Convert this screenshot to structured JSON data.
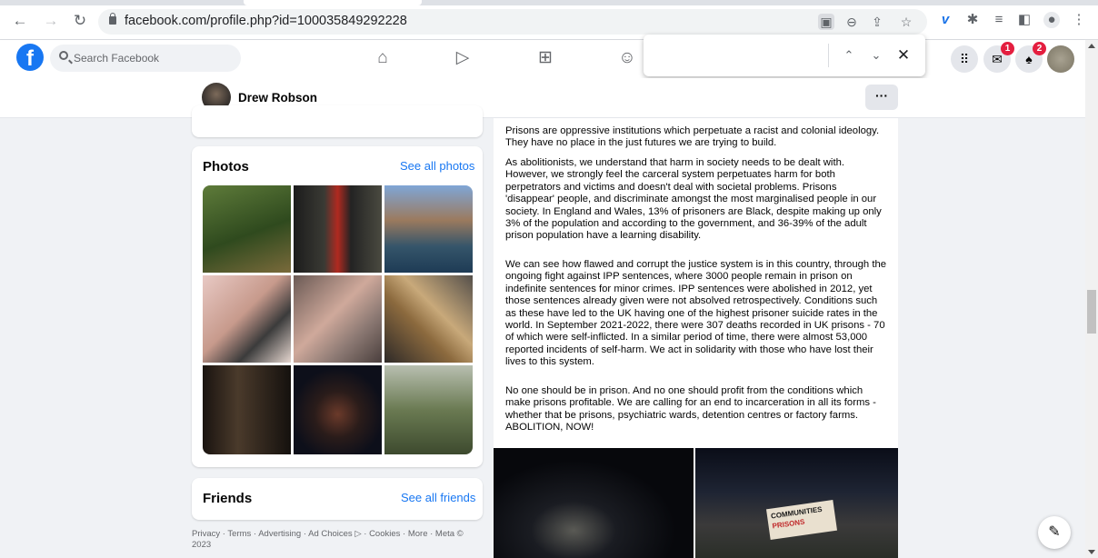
{
  "browser": {
    "url": "facebook.com/profile.php?id=100035849292228",
    "back_icon": "arrow-left-icon",
    "forward_icon": "arrow-right-icon",
    "reload_icon": "reload-icon"
  },
  "find_bar": {
    "query": "",
    "prev_icon": "chevron-up-icon",
    "next_icon": "chevron-down-icon",
    "close_icon": "close-icon"
  },
  "facebook": {
    "search_placeholder": "Search Facebook",
    "messenger_badge": "1",
    "notifications_badge": "2"
  },
  "profile": {
    "name": "Drew Robson",
    "more_label": "···"
  },
  "photos": {
    "title": "Photos",
    "see_all": "See all photos"
  },
  "friends": {
    "title": "Friends",
    "see_all": "See all friends"
  },
  "footer": {
    "text": "Privacy · Terms · Advertising · Ad Choices ▷ · Cookies · More · Meta © 2023"
  },
  "post": {
    "paragraphs": [
      "Prisons are oppressive institutions which perpetuate a racist and colonial ideology. They have no place in the just futures we are trying to build.",
      "As abolitionists, we understand that harm in society needs to be dealt with. However, we strongly feel the carceral system perpetuates harm for both perpetrators and victims and doesn't deal with societal problems. Prisons 'disappear' people, and discriminate amongst the most marginalised people in our society. In England and Wales, 13% of prisoners are Black, despite making up only 3% of the population and according to the government, and 36-39% of the adult prison population have a learning disability.",
      "We can see how flawed and corrupt the justice system is in this country, through the ongoing fight against IPP sentences, where 3000 people remain in prison on indefinite sentences for minor crimes. IPP sentences were abolished in 2012, yet those sentences already given were not absolved retrospectively. Conditions such as these have led to the UK having one of the highest prisoner suicide rates in the world. In September 2021-2022, there were 307 deaths recorded in UK prisons - 70 of which were self-inflicted. In a similar period of time, there were almost 53,000 reported incidents of self-harm. We act in solidarity with those who have lost their lives to this system.",
      "No one should be in prison. And no one should profit from the conditions which make prisons profitable. We are calling for an end to incarceration in all its forms - whether that be prisons, psychiatric wards, detention centres or factory farms. ABOLITION, NOW!"
    ],
    "banner_text_1": "COMMUNITIES",
    "banner_text_2": "PRISONS"
  }
}
